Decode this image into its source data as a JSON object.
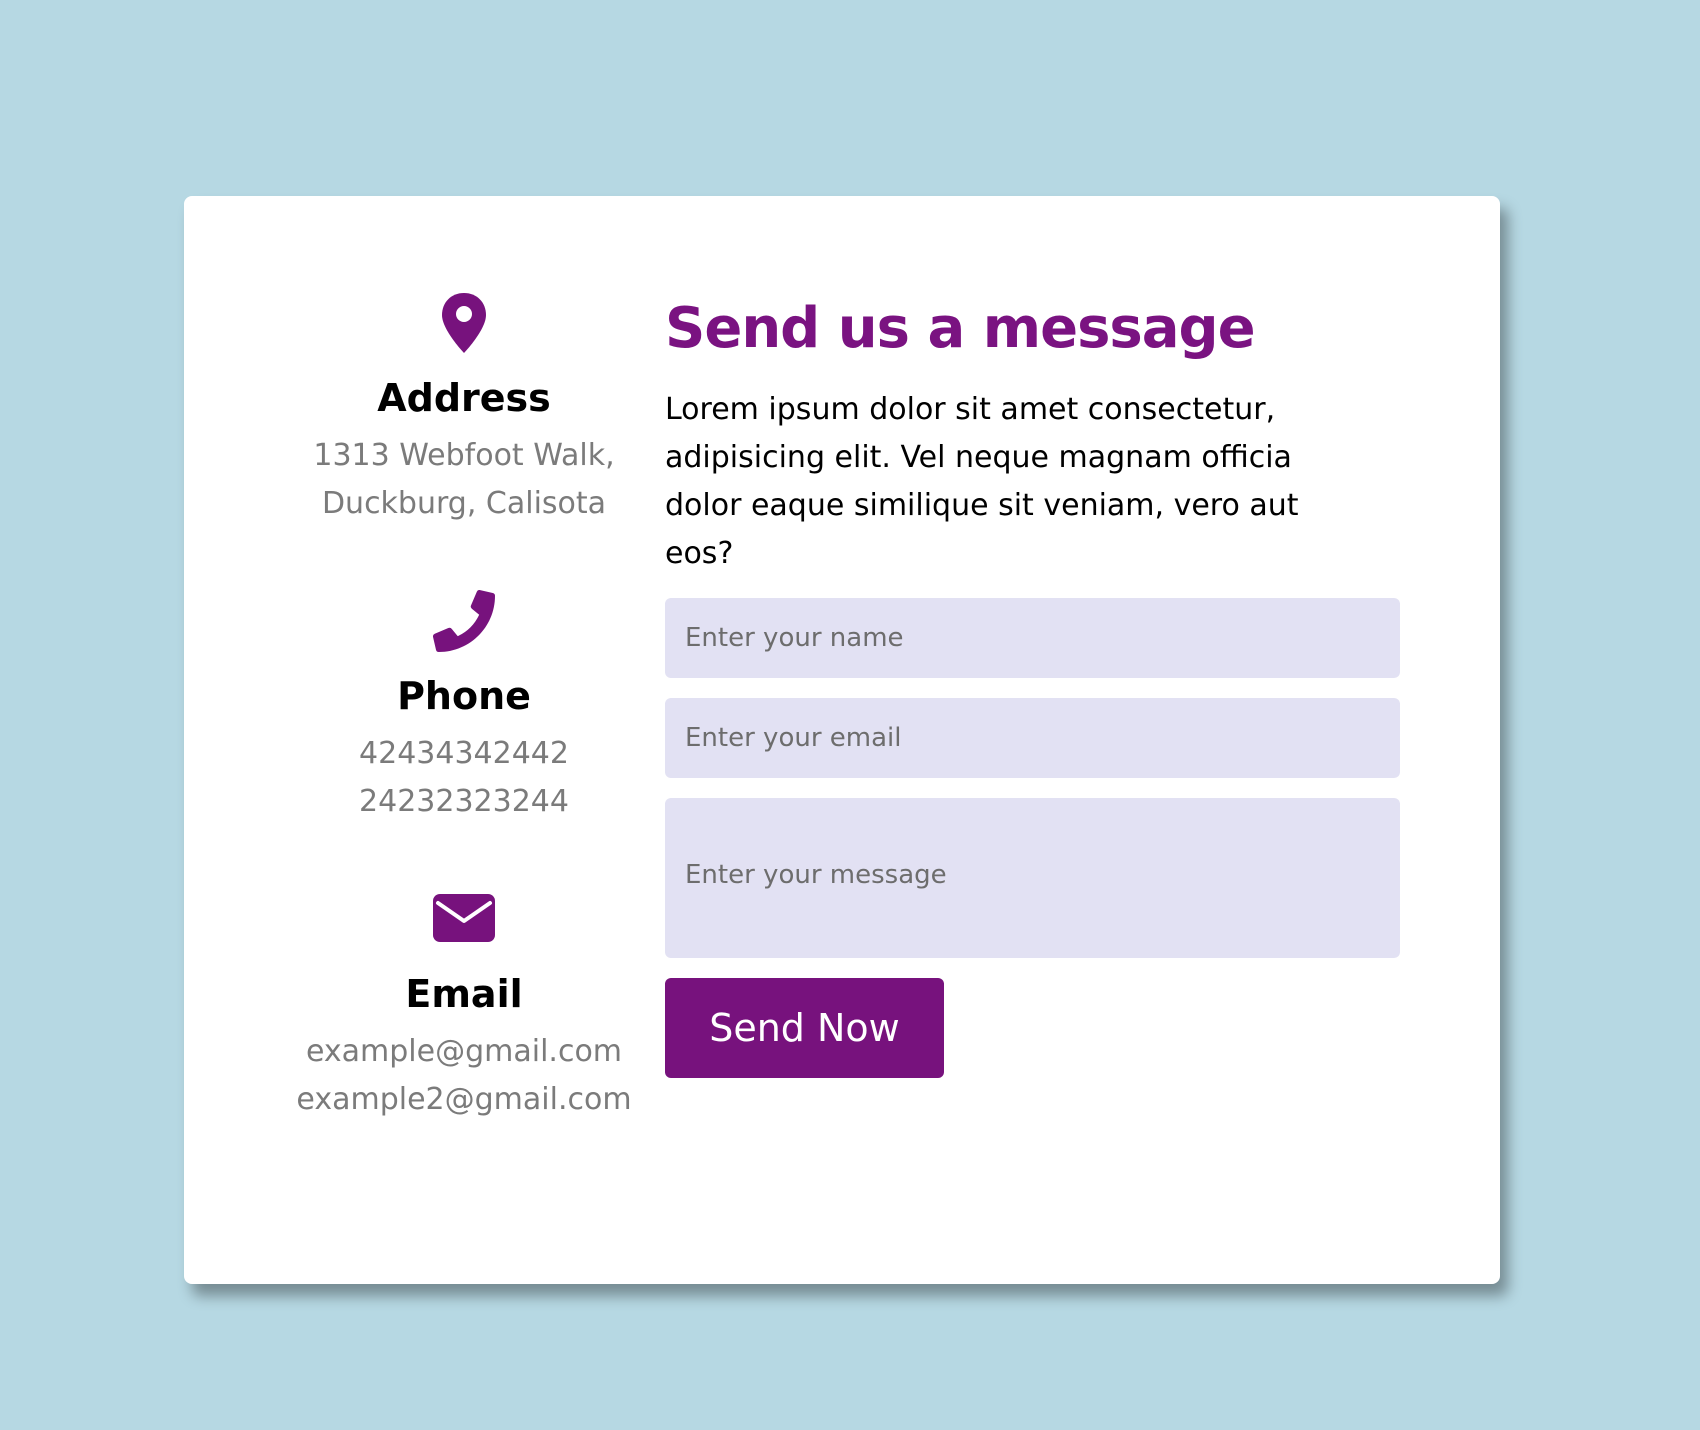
{
  "contact_info": {
    "address": {
      "icon": "map-pin-icon",
      "title": "Address",
      "lines": [
        "1313 Webfoot Walk,",
        "Duckburg, Calisota"
      ]
    },
    "phone": {
      "icon": "phone-icon",
      "title": "Phone",
      "lines": [
        "42434342442",
        "24232323244"
      ]
    },
    "email": {
      "icon": "envelope-icon",
      "title": "Email",
      "lines": [
        "example@gmail.com",
        "example2@gmail.com"
      ]
    }
  },
  "form": {
    "heading": "Send us a message",
    "intro": "Lorem ipsum dolor sit amet consectetur, adipisicing elit. Vel neque magnam officia dolor eaque similique sit veniam, vero aut eos?",
    "name_placeholder": "Enter your name",
    "email_placeholder": "Enter your email",
    "message_placeholder": "Enter your message",
    "submit_label": "Send Now"
  },
  "colors": {
    "background": "#b6d8e3",
    "card": "#ffffff",
    "accent": "#77127d",
    "input_bg": "#e2e1f3",
    "muted_text": "#7b7b7b"
  }
}
